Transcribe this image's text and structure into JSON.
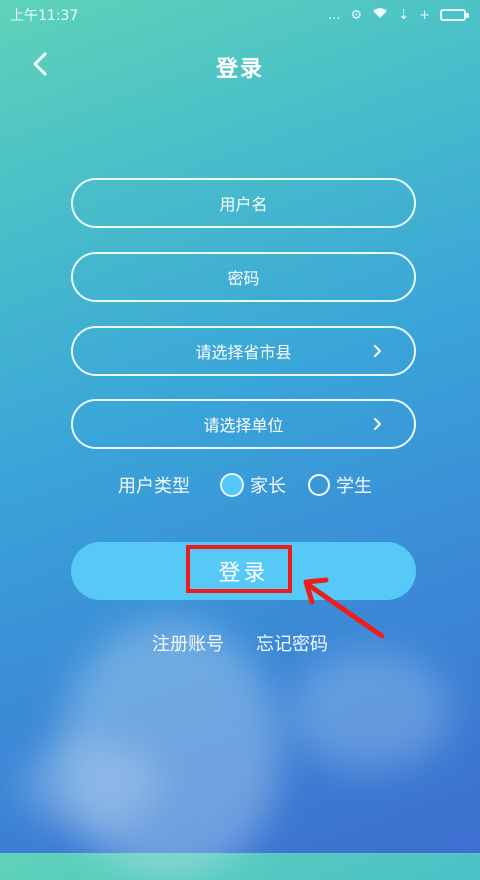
{
  "status_bar": {
    "time": "上午11:37",
    "right_text": "..."
  },
  "header": {
    "title": "登录"
  },
  "form": {
    "username_placeholder": "用户名",
    "password_placeholder": "密码",
    "region_placeholder": "请选择省市县",
    "unit_placeholder": "请选择单位"
  },
  "user_type": {
    "label": "用户类型",
    "options": [
      {
        "label": "家长",
        "selected": true
      },
      {
        "label": "学生",
        "selected": false
      }
    ]
  },
  "login_button": {
    "label": "登录"
  },
  "links": {
    "register": "注册账号",
    "forgot": "忘记密码"
  },
  "colors": {
    "highlight": "#ef1c1c",
    "button": "#56c9f7"
  }
}
